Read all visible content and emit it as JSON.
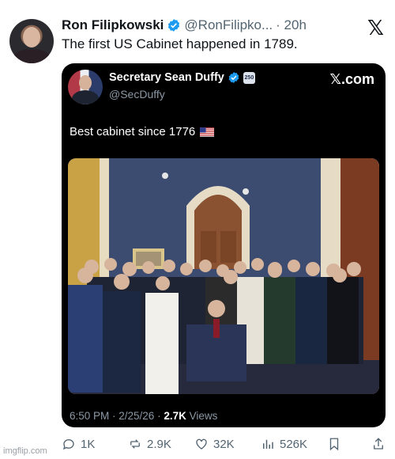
{
  "tweet": {
    "author_name": "Ron Filipkowski",
    "handle": "@RonFilipko...",
    "time": "· 20h",
    "text": "The first US Cabinet happened in 1789.",
    "platform_logo_icon": "x-logo-icon",
    "verified_color": "#1d9bf0"
  },
  "embedded_post": {
    "author_name": "Secretary Sean Duffy",
    "handle": "@SecDuffy",
    "brand": "𝕏.com",
    "text": "Best cabinet since 1776",
    "photo_description_icon": "group-photo",
    "timestamp": "6:50 PM · 2/25/26 · ",
    "views_count": "2.7K",
    "views_label": " Views",
    "gov_badge_text": "250"
  },
  "actions": {
    "replies": "1K",
    "reposts": "2.9K",
    "likes": "32K",
    "views": "526K"
  },
  "watermark": "imgflip.com"
}
